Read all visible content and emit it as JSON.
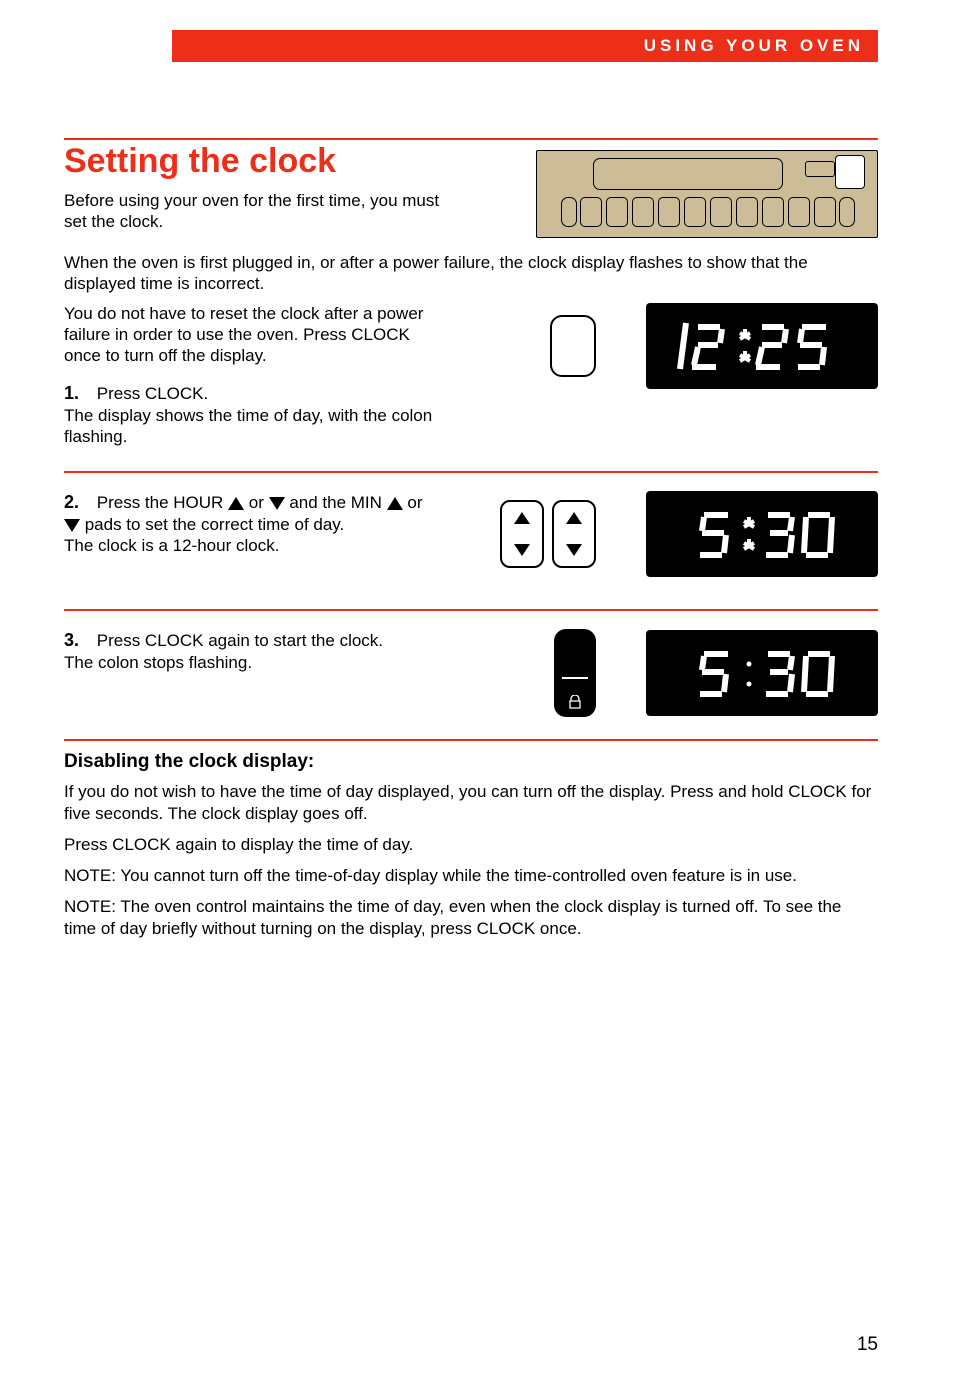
{
  "header": "USING YOUR OVEN",
  "title": "Setting the clock",
  "intro_before_title": "Before using your oven for the first time, you must set the clock.",
  "intro_paras": [
    "When the oven is first plugged in, or after a power failure, the clock display flashes to show that the displayed time is incorrect.",
    "You do not have to reset the clock after a power failure in order to use the oven. Press CLOCK once to turn off the display."
  ],
  "steps": [
    {
      "num": "1.",
      "text": "Press CLOCK.\nThe display shows the time of day, with the colon flashing."
    },
    {
      "num": "2.",
      "text": "Press the HOUR ▲ or ▼ and the MIN ▲ or ▼ pads to set the correct time of day.\nThe clock is a 12-hour clock."
    },
    {
      "num": "3.",
      "text": "Press CLOCK again to start the clock.\nThe colon stops flashing."
    }
  ],
  "disable_heading": "Disabling the clock display:",
  "disable_paras": [
    "If you do not wish to have the time of day displayed, you can turn off the display. Press and hold CLOCK for five seconds. The clock display goes off.",
    "Press CLOCK again to display the time of day.",
    "NOTE: You cannot turn off the time-of-day display while the time-controlled oven feature is in use.",
    "NOTE: The oven control maintains the time of day, even when the clock display is turned off. To see the time of day briefly without turning on the display, press CLOCK once."
  ],
  "page_number": "15",
  "display_values": {
    "step1": "12:25",
    "step2": "5:30",
    "step3": "5:30"
  }
}
